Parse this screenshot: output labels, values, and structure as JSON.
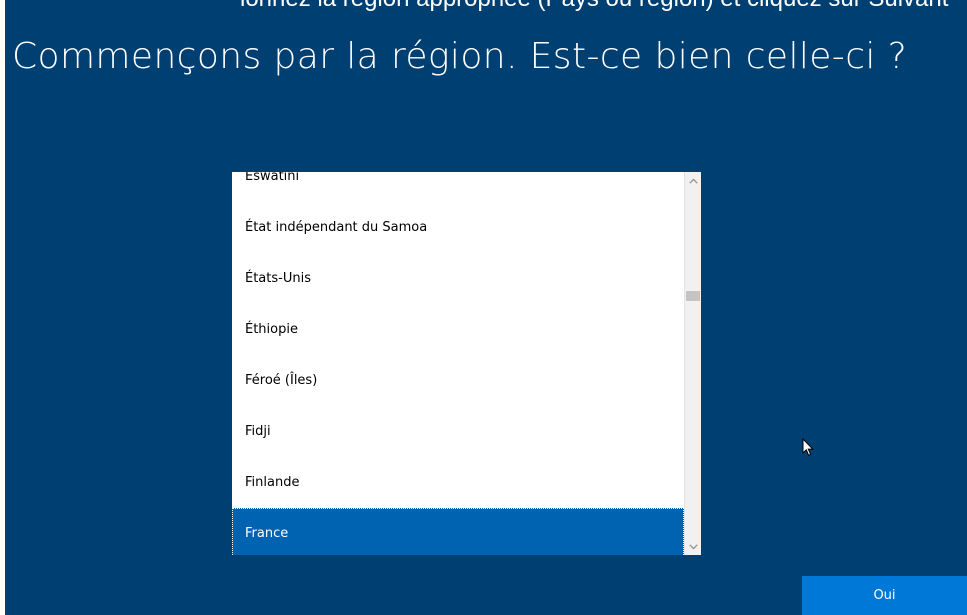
{
  "page": {
    "top_cutoff_text": "ionnez la région appropriée (Pays ou région) et cliquez sur Suivant",
    "heading": "Commençons par la région. Est-ce bien celle-ci ?"
  },
  "region_list": {
    "items": [
      {
        "label": "Eswatini"
      },
      {
        "label": "État indépendant du Samoa"
      },
      {
        "label": "États-Unis"
      },
      {
        "label": "Éthiopie"
      },
      {
        "label": "Féroé (Îles)"
      },
      {
        "label": "Fidji"
      },
      {
        "label": "Finlande"
      },
      {
        "label": "France"
      }
    ],
    "selected": "France",
    "scroll_position": 0.33
  },
  "actions": {
    "confirm_label": "Oui"
  },
  "icons": {
    "scroll_up": "chevron-up-icon",
    "scroll_down": "chevron-down-icon",
    "cursor": "mouse-pointer-icon"
  },
  "colors": {
    "background": "#003f72",
    "selection": "#0063b1",
    "button": "#0078d7",
    "text": "#ffffff"
  }
}
